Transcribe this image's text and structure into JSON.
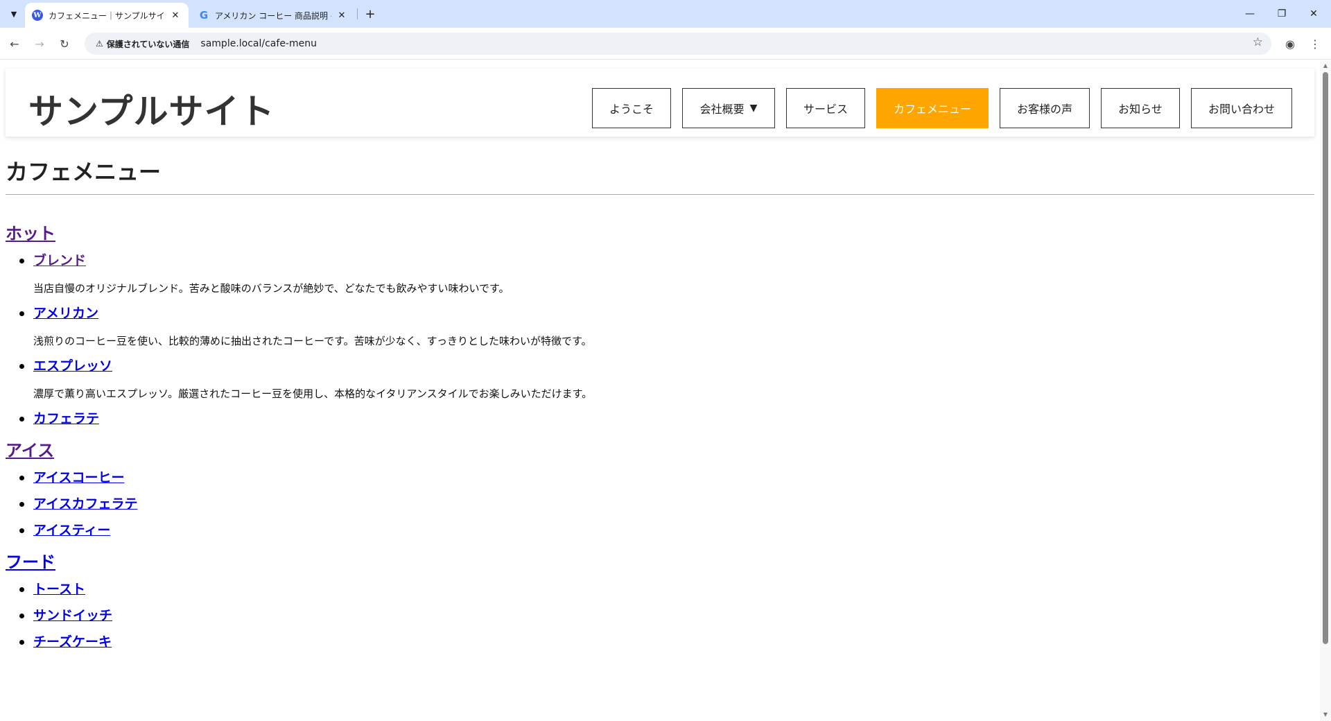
{
  "browser": {
    "tabs": [
      {
        "title": "カフェメニュー｜サンプルサイト",
        "favicon": "wordpress-icon",
        "active": true
      },
      {
        "title": "アメリカン コーヒー 商品説明 - Goo",
        "favicon": "google-icon",
        "active": false
      }
    ],
    "security_label": "保護されていない通信",
    "url": "sample.local/cafe-menu"
  },
  "site": {
    "title": "サンプルサイト",
    "nav": [
      {
        "label": "ようこそ"
      },
      {
        "label": "会社概要",
        "has_dropdown": true,
        "caret": "▼"
      },
      {
        "label": "サービス"
      },
      {
        "label": "カフェメニュー",
        "active": true
      },
      {
        "label": "お客様の声"
      },
      {
        "label": "お知らせ"
      },
      {
        "label": "お問い合わせ"
      }
    ],
    "active_color": "#ffa500"
  },
  "page": {
    "title": "カフェメニュー",
    "categories": [
      {
        "name": "ホット",
        "items": [
          {
            "name": "ブレンド",
            "description": "当店自慢のオリジナルブレンド。苦みと酸味のバランスが絶妙で、どなたでも飲みやすい味わいです。"
          },
          {
            "name": "アメリカン",
            "description": "浅煎りのコーヒー豆を使い、比較的薄めに抽出されたコーヒーです。苦味が少なく、すっきりとした味わいが特徴です。"
          },
          {
            "name": "エスプレッソ",
            "description": "濃厚で薫り高いエスプレッソ。厳選されたコーヒー豆を使用し、本格的なイタリアンスタイルでお楽しみいただけます。"
          },
          {
            "name": "カフェラテ"
          }
        ]
      },
      {
        "name": "アイス",
        "items": [
          {
            "name": "アイスコーヒー"
          },
          {
            "name": "アイスカフェラテ"
          },
          {
            "name": "アイスティー"
          }
        ]
      },
      {
        "name": "フード",
        "items": [
          {
            "name": "トースト"
          },
          {
            "name": "サンドイッチ"
          },
          {
            "name": "チーズケーキ"
          }
        ]
      }
    ]
  }
}
